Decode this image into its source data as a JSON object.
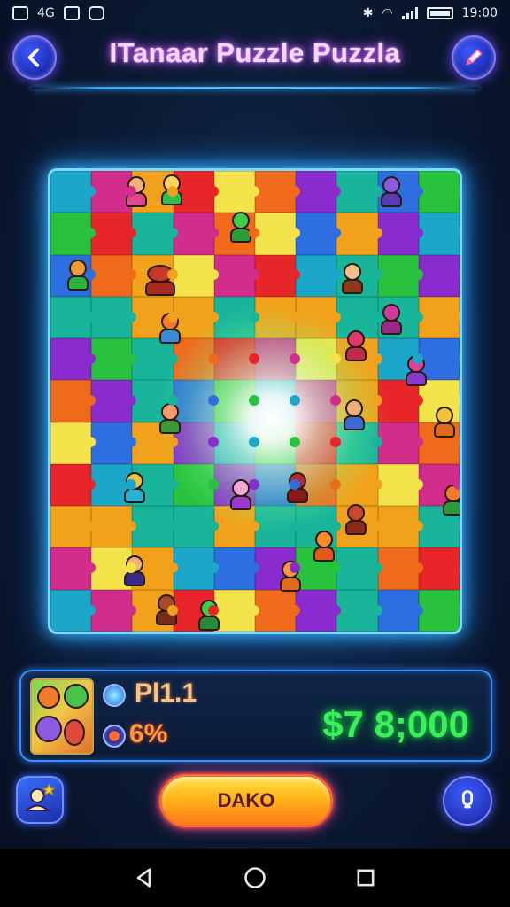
{
  "status_bar": {
    "left_icons": [
      "photo-icon",
      "wifi-calling-icon",
      "screen-icon",
      "android-icon"
    ],
    "left_text": "4G",
    "time": "19:00",
    "right_icons": [
      "bluetooth-icon",
      "wifi-icon",
      "signal-icon",
      "battery-icon"
    ]
  },
  "header": {
    "title": "ITanaar Puzzle Puzzla",
    "back_icon": "chevron-left-icon",
    "edit_icon": "pencil-icon"
  },
  "board": {
    "columns": 10,
    "rows": 11,
    "palette": [
      "#1aa7c9",
      "#e8262a",
      "#8a2bd0",
      "#29c23f",
      "#f2a21a",
      "#f06a1c",
      "#2d6fe0",
      "#d22c8c",
      "#f4e24a",
      "#19b59a"
    ]
  },
  "info_panel": {
    "pieces_label": "Pl1.1",
    "progress_label": "6%",
    "score": "$7 8;000"
  },
  "controls": {
    "play_label": "DAKO",
    "left_icon": "profile-star-icon",
    "right_icon": "microphone-icon"
  },
  "nav": {
    "icons": [
      "back-triangle-icon",
      "home-circle-icon",
      "recents-square-icon"
    ]
  }
}
